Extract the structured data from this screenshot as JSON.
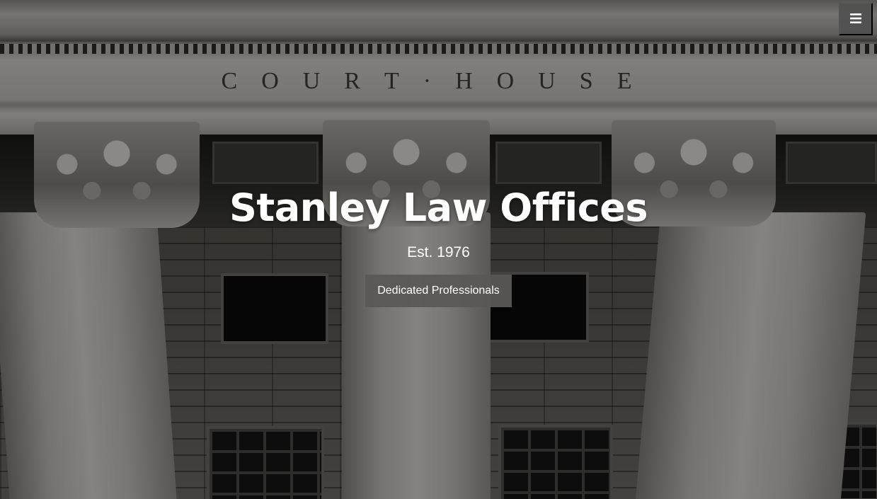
{
  "background": {
    "frieze_letters": [
      "C",
      "O",
      "U",
      "R",
      "T",
      "·",
      "H",
      "O",
      "U",
      "S",
      "E"
    ]
  },
  "nav": {
    "menu_icon": "hamburger-menu-icon"
  },
  "hero": {
    "title": "Stanley Law Offices",
    "subtitle": "Est. 1976",
    "button_label": "Dedicated Professionals"
  },
  "colors": {
    "title_text": "#ffffff",
    "button_bg": "#5a5855",
    "menu_bg": "#505050"
  }
}
